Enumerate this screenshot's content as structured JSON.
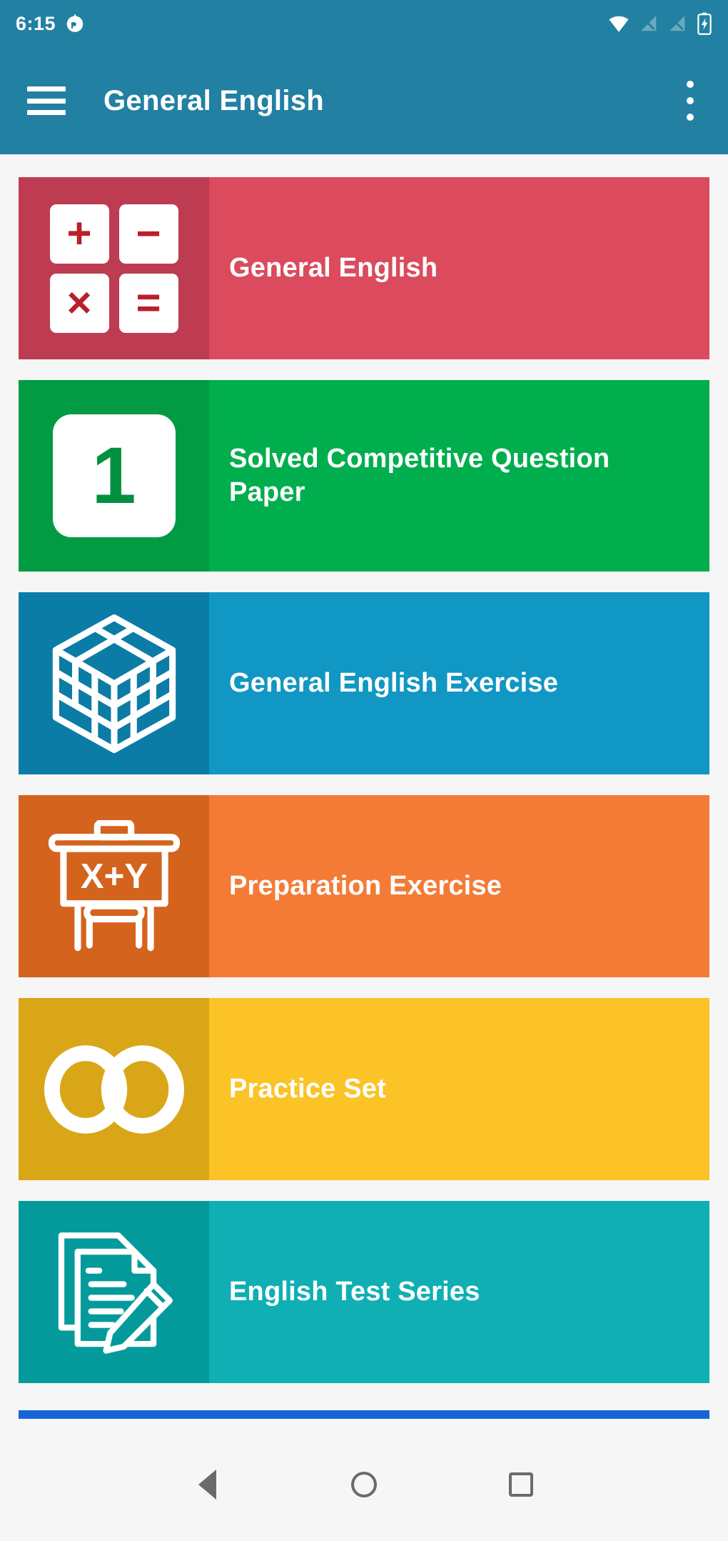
{
  "status_bar": {
    "time": "6:15",
    "icons_left": [
      "notification-badge-icon"
    ],
    "icons_right": [
      "wifi-icon",
      "signal-no-sim-icon",
      "signal-no-sim-icon",
      "battery-icon"
    ],
    "background_color": "#2280A2"
  },
  "app_bar": {
    "menu_icon": "hamburger-menu-icon",
    "title": "General English",
    "overflow_icon": "more-vert-icon",
    "background_color": "#2280A2"
  },
  "list": {
    "items": [
      {
        "label": "General English",
        "icon": "calculator-icon",
        "icon_keys": [
          "+",
          "−",
          "×",
          "="
        ],
        "body_color": "#DB4A5D",
        "icon_panel_color": "#BE3C52",
        "glyph_color": "#BA1F2B"
      },
      {
        "label": "Solved Competitive Question Paper",
        "icon": "number-one-tile-icon",
        "icon_text": "1",
        "body_color": "#00AE4D",
        "icon_panel_color": "#009B43",
        "glyph_color": "#00913F"
      },
      {
        "label": "General English Exercise",
        "icon": "cube-3d-icon",
        "body_color": "#1097C4",
        "icon_panel_color": "#0B7CA5",
        "glyph_color": "#FFFFFF"
      },
      {
        "label": "Preparation Exercise",
        "icon": "whiteboard-xplusy-icon",
        "icon_text": "X+Y",
        "body_color": "#F47B36",
        "icon_panel_color": "#D4631D",
        "glyph_color": "#FFFFFF"
      },
      {
        "label": "Practice Set",
        "icon": "infinity-icon",
        "body_color": "#FBC325",
        "icon_panel_color": "#D9A618",
        "glyph_color": "#FFFFFF"
      },
      {
        "label": "English Test Series",
        "icon": "documents-pencil-icon",
        "body_color": "#0FAFB4",
        "icon_panel_color": "#049A9C",
        "glyph_color": "#FFFFFF"
      }
    ]
  },
  "scroll_indicator": {
    "color": "#1565D8"
  },
  "navigation_bar": {
    "back_icon": "back-triangle-icon",
    "home_icon": "home-circle-icon",
    "recents_icon": "recents-square-icon",
    "background_color": "#F6F6F6"
  }
}
